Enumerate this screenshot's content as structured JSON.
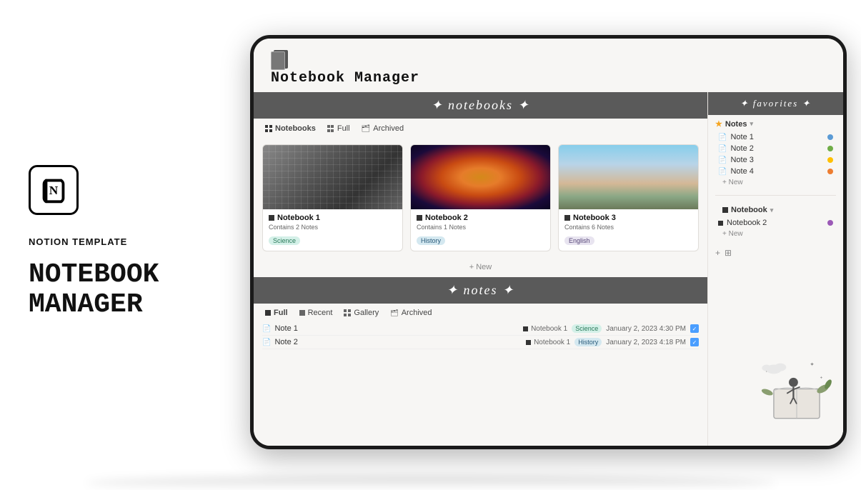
{
  "branding": {
    "template_label": "NOTION TEMPLATE",
    "product_name_line1": "NOTEBOOK",
    "product_name_line2": "MANAGER"
  },
  "app": {
    "title": "Notebook Manager",
    "icon_alt": "notebook-icon"
  },
  "notebooks_section": {
    "header": "✦ notebooks ✦",
    "tabs": [
      {
        "label": "Notebooks",
        "icon": "grid",
        "active": true
      },
      {
        "label": "Full",
        "icon": "grid",
        "active": false
      },
      {
        "label": "Archived",
        "icon": "archive",
        "active": false
      }
    ],
    "notebooks": [
      {
        "name": "Notebook 1",
        "notes_count": "Contains 2 Notes",
        "tag": "Science",
        "tag_class": "tag-science",
        "img_class": "nb-img-1"
      },
      {
        "name": "Notebook 2",
        "notes_count": "Contains 1 Notes",
        "tag": "History",
        "tag_class": "tag-history",
        "img_class": "nb-img-2"
      },
      {
        "name": "Notebook 3",
        "notes_count": "Contains 6 Notes",
        "tag": "English",
        "tag_class": "tag-english",
        "img_class": "nb-img-3"
      }
    ],
    "new_button": "+ New"
  },
  "notes_section": {
    "header": "✦ notes ✦",
    "tabs": [
      {
        "label": "Full",
        "icon": "square",
        "active": true
      },
      {
        "label": "Recent",
        "icon": "square",
        "active": false
      },
      {
        "label": "Gallery",
        "icon": "grid",
        "active": false
      },
      {
        "label": "Archived",
        "icon": "archive",
        "active": false
      }
    ],
    "notes": [
      {
        "name": "Note 1",
        "notebook": "Notebook 1",
        "tag": "Science",
        "tag_class": "tag-science",
        "date": "January 2, 2023 4:30 PM",
        "checked": true
      },
      {
        "name": "Note 2",
        "notebook": "Notebook 1",
        "tag": "History",
        "tag_class": "tag-history",
        "date": "January 2, 2023 4:18 PM",
        "checked": true
      }
    ]
  },
  "favorites_sidebar": {
    "header": "✦ favorites ✦",
    "notes_group": {
      "title": "Notes",
      "items": [
        {
          "name": "Note 1",
          "color": "color-blue"
        },
        {
          "name": "Note 2",
          "color": "color-green"
        },
        {
          "name": "Note 3",
          "color": "color-yellow"
        },
        {
          "name": "Note 4",
          "color": "color-orange"
        }
      ],
      "new_label": "+ New"
    },
    "notebook_group": {
      "title": "Notebook",
      "items": [
        {
          "name": "Notebook 2",
          "color": "color-purple"
        }
      ],
      "new_label": "+ New"
    }
  }
}
